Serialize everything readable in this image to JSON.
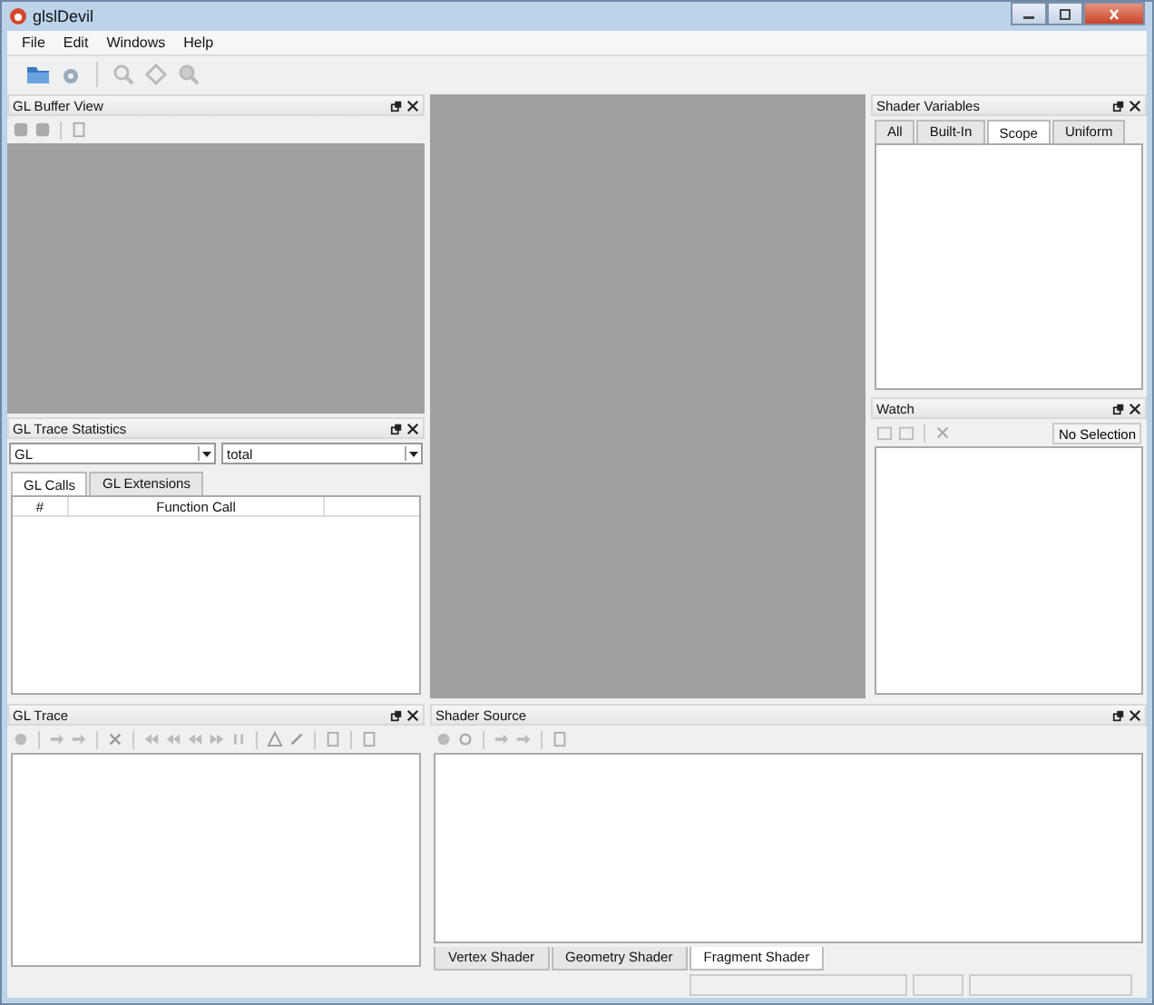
{
  "window": {
    "title": "glslDevil"
  },
  "menu": [
    {
      "label": "File"
    },
    {
      "label": "Edit"
    },
    {
      "label": "Windows"
    },
    {
      "label": "Help"
    }
  ],
  "buffer_view": {
    "title": "GL Buffer View"
  },
  "trace_statistics": {
    "title": "GL Trace Statistics",
    "filter": "GL",
    "mode": "total",
    "tabs": [
      {
        "label": "GL Calls",
        "selected": true
      },
      {
        "label": "GL Extensions",
        "selected": false
      }
    ],
    "columns": [
      "#",
      "Function Call"
    ]
  },
  "shader_variables": {
    "title": "Shader Variables",
    "tabs": [
      {
        "label": "All",
        "selected": false
      },
      {
        "label": "Built-In",
        "selected": false
      },
      {
        "label": "Scope",
        "selected": true
      },
      {
        "label": "Uniform",
        "selected": false
      }
    ]
  },
  "watch": {
    "title": "Watch",
    "selection": "No Selection"
  },
  "gl_trace": {
    "title": "GL Trace"
  },
  "shader_source": {
    "title": "Shader Source",
    "tabs": [
      {
        "label": "Vertex Shader",
        "selected": false
      },
      {
        "label": "Geometry Shader",
        "selected": false
      },
      {
        "label": "Fragment Shader",
        "selected": true
      }
    ]
  }
}
